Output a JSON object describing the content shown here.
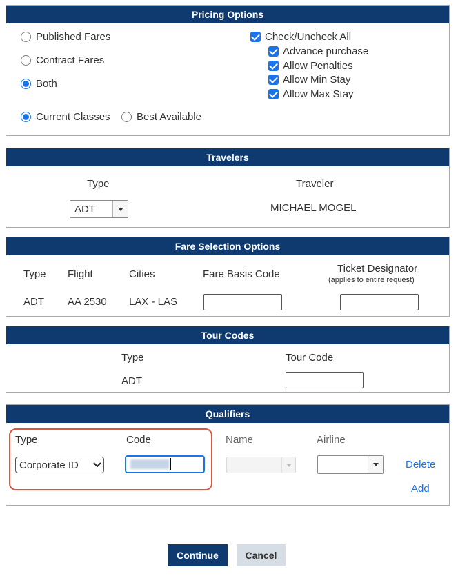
{
  "pricing": {
    "header": "Pricing Options",
    "fare_types": [
      {
        "label": "Published Fares",
        "selected": false
      },
      {
        "label": "Contract Fares",
        "selected": false
      },
      {
        "label": "Both",
        "selected": true
      }
    ],
    "class_options": [
      {
        "label": "Current Classes",
        "selected": true
      },
      {
        "label": "Best Available",
        "selected": false
      }
    ],
    "check_all": {
      "label": "Check/Uncheck All",
      "checked": true
    },
    "checks": [
      {
        "label": "Advance purchase",
        "checked": true
      },
      {
        "label": "Allow Penalties",
        "checked": true
      },
      {
        "label": "Allow Min Stay",
        "checked": true
      },
      {
        "label": "Allow Max Stay",
        "checked": true
      }
    ]
  },
  "travelers": {
    "header": "Travelers",
    "col_type": "Type",
    "col_traveler": "Traveler",
    "type_value": "ADT",
    "traveler_name": "MICHAEL MOGEL"
  },
  "fare_selection": {
    "header": "Fare Selection Options",
    "columns": {
      "type": "Type",
      "flight": "Flight",
      "cities": "Cities",
      "fare_basis": "Fare Basis Code",
      "ticket_designator": "Ticket Designator",
      "ticket_designator_note": "(applies to entire request)"
    },
    "row": {
      "type": "ADT",
      "flight": "AA 2530",
      "cities": "LAX - LAS",
      "fare_basis": "",
      "ticket_designator": ""
    }
  },
  "tour_codes": {
    "header": "Tour Codes",
    "col_type": "Type",
    "col_tour_code": "Tour Code",
    "row_type": "ADT",
    "tour_code": ""
  },
  "qualifiers": {
    "header": "Qualifiers",
    "col_type": "Type",
    "col_code": "Code",
    "col_name": "Name",
    "col_airline": "Airline",
    "type_value": "Corporate ID",
    "delete_label": "Delete",
    "add_label": "Add",
    "highlight_color": "#d9573f"
  },
  "actions": {
    "continue_label": "Continue",
    "cancel_label": "Cancel"
  },
  "colors": {
    "header_bg": "#0e3a6f",
    "accent": "#1a73e8"
  }
}
